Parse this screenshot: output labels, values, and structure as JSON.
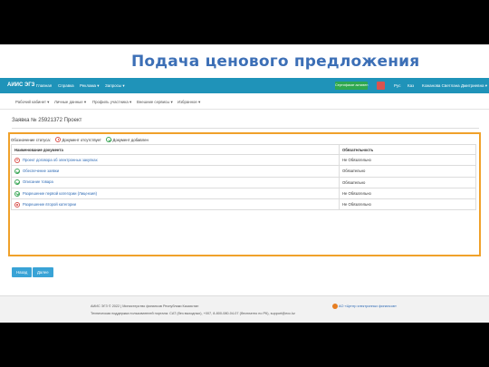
{
  "slide_title": "Подача ценового предложения",
  "topbar": {
    "brand": "АИИС ЭГЗ",
    "menu": [
      "Главная",
      "Справка",
      "Реклама ▾",
      "Запросы ▾"
    ],
    "certificate": "Сертификат активен",
    "lang_ru": "Рус",
    "lang_kz": "Каз",
    "user": "Кожанова Светлана Дмитриевна ▾",
    "colors": {
      "bar": "#1f93b9",
      "cert": "#2fa84f",
      "flag": "#d9534f"
    }
  },
  "subnav": [
    "Рабочий кабинет ▾",
    "Личные данные ▾",
    "Профиль участника ▾",
    "Внешние сервисы ▾",
    "Избранное ▾"
  ],
  "page_title": "Заявка № 25921372 Проект",
  "legend": {
    "label": "Обозначение статуса:",
    "missing": "Документ отсутствует",
    "added": "Документ добавлен"
  },
  "table": {
    "headers": [
      "Наименование документа",
      "Обязательность"
    ],
    "rows": [
      {
        "status": "missing",
        "name": "Проект договора об электронных закупках",
        "required": "Не Обязательно"
      },
      {
        "status": "added",
        "name": "Обеспечение заявки",
        "required": "Обязательно"
      },
      {
        "status": "added",
        "name": "Описание товара",
        "required": "Обязательно"
      },
      {
        "status": "added",
        "name": "Разрешение первой категории (Лицензия)",
        "required": "Не Обязательно"
      },
      {
        "status": "missing",
        "name": "Разрешение второй категории",
        "required": "Не Обязательно"
      }
    ]
  },
  "buttons": {
    "back": "Назад",
    "next": "Далее"
  },
  "footer": {
    "line1": "АИИС ЭГЗ © 2022 | Министерство финансов Республики Казахстан",
    "line2": "Техническая поддержка пользователей портала: CAT (без выходных), +007, 8-800-080-04-07 (бесплатно по РК), support@ecc.kz",
    "org": "АО «Центр электронных финансов»"
  }
}
